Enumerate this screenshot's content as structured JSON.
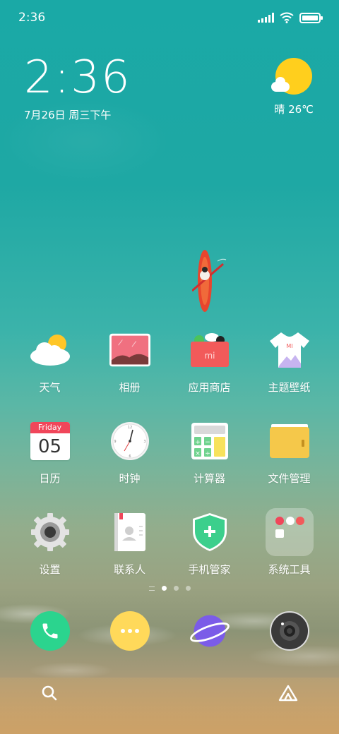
{
  "status_bar": {
    "time": "2:36"
  },
  "clock_widget": {
    "time": "2:36",
    "date": "7月26日 周三下午"
  },
  "weather_widget": {
    "condition_temp": "晴 26℃"
  },
  "apps": [
    {
      "label": "天气",
      "icon": "weather-icon"
    },
    {
      "label": "相册",
      "icon": "gallery-icon"
    },
    {
      "label": "应用商店",
      "icon": "app-store-icon"
    },
    {
      "label": "主题壁纸",
      "icon": "themes-icon"
    },
    {
      "label": "日历",
      "icon": "calendar-icon",
      "day_name": "Friday",
      "day_number": "05"
    },
    {
      "label": "时钟",
      "icon": "clock-icon"
    },
    {
      "label": "计算器",
      "icon": "calculator-icon"
    },
    {
      "label": "文件管理",
      "icon": "file-manager-icon"
    },
    {
      "label": "设置",
      "icon": "settings-icon"
    },
    {
      "label": "联系人",
      "icon": "contacts-icon"
    },
    {
      "label": "手机管家",
      "icon": "security-icon"
    },
    {
      "label": "系统工具",
      "icon": "folder-icon"
    }
  ],
  "page_indicator": {
    "pages": 3,
    "active": 1
  },
  "dock": [
    {
      "icon": "phone-icon",
      "color": "#2bd48e"
    },
    {
      "icon": "messages-icon",
      "color": "#ffd95a"
    },
    {
      "icon": "browser-icon",
      "color": "#7b5ce8"
    },
    {
      "icon": "camera-icon",
      "color": "#3a3a3a"
    }
  ],
  "colors": {
    "calendar_red": "#f0465a",
    "gallery_pink": "#f07080",
    "appstore_red": "#f25a5a",
    "security_green": "#3ccf8c",
    "folder_yellow": "#f5c84a",
    "sun_yellow": "#ffcf1d"
  }
}
